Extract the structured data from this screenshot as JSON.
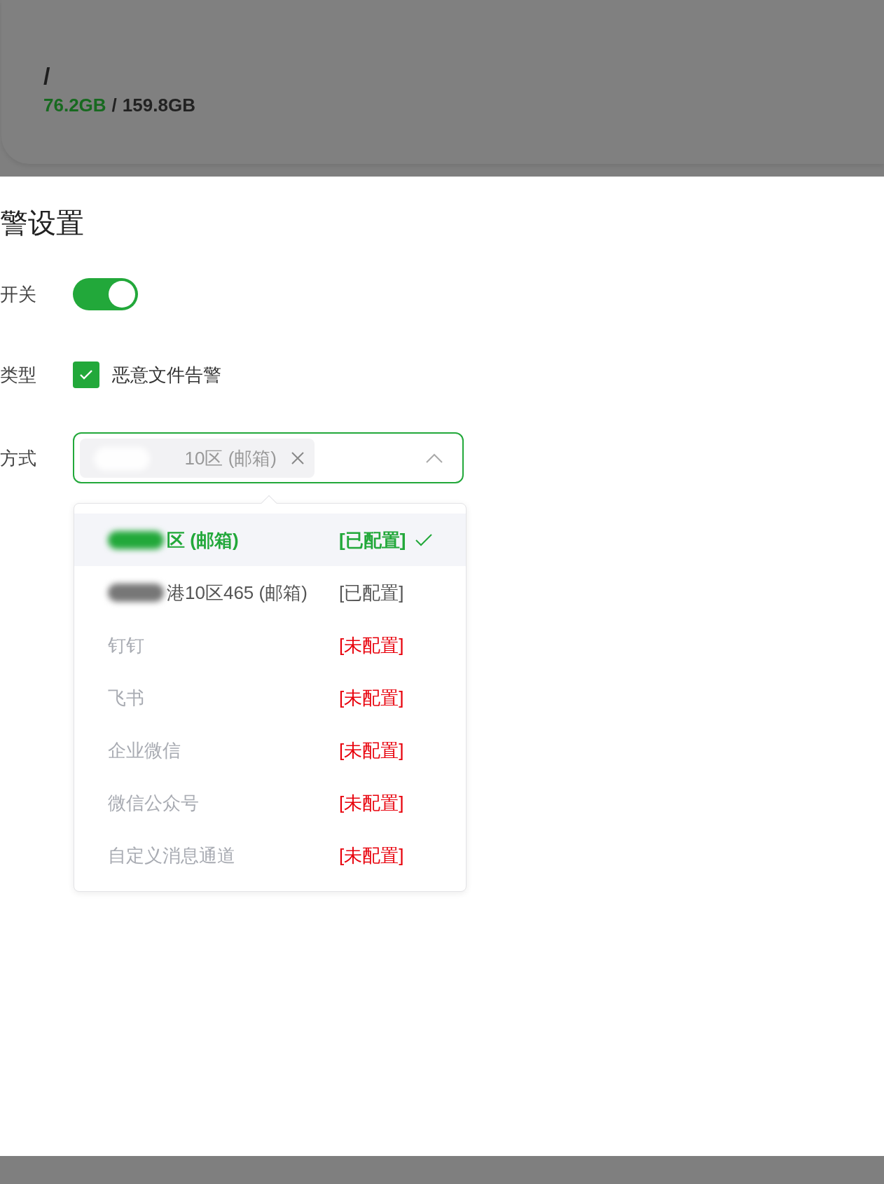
{
  "disk_card": {
    "mount": "/",
    "used": "76.2GB",
    "separator": "/",
    "total": "159.8GB"
  },
  "panel": {
    "title": "警设置",
    "fields": [
      {
        "kind": "switch",
        "label": "开关",
        "on": true
      },
      {
        "kind": "checkbox",
        "label": "类型",
        "option": "恶意文件告警",
        "checked": true
      },
      {
        "kind": "select",
        "label": "方式",
        "expanded": true,
        "tags": [
          {
            "text": "10区 (邮箱)",
            "blurred": true
          }
        ]
      }
    ],
    "options": [
      {
        "name": "区 (邮箱)",
        "blurred": true,
        "status": "[已配置]",
        "configured": true,
        "selected": true,
        "disabled": false
      },
      {
        "name": "港10区465 (邮箱)",
        "blurred": true,
        "status": "[已配置]",
        "configured": true,
        "selected": false,
        "disabled": false
      },
      {
        "name": "钉钉",
        "blurred": false,
        "status": "[未配置]",
        "configured": false,
        "selected": false,
        "disabled": true
      },
      {
        "name": "飞书",
        "blurred": false,
        "status": "[未配置]",
        "configured": false,
        "selected": false,
        "disabled": true
      },
      {
        "name": "企业微信",
        "blurred": false,
        "status": "[未配置]",
        "configured": false,
        "selected": false,
        "disabled": true
      },
      {
        "name": "微信公众号",
        "blurred": false,
        "status": "[未配置]",
        "configured": false,
        "selected": false,
        "disabled": true
      },
      {
        "name": "自定义消息通道",
        "blurred": false,
        "status": "[未配置]",
        "configured": false,
        "selected": false,
        "disabled": true
      }
    ]
  }
}
